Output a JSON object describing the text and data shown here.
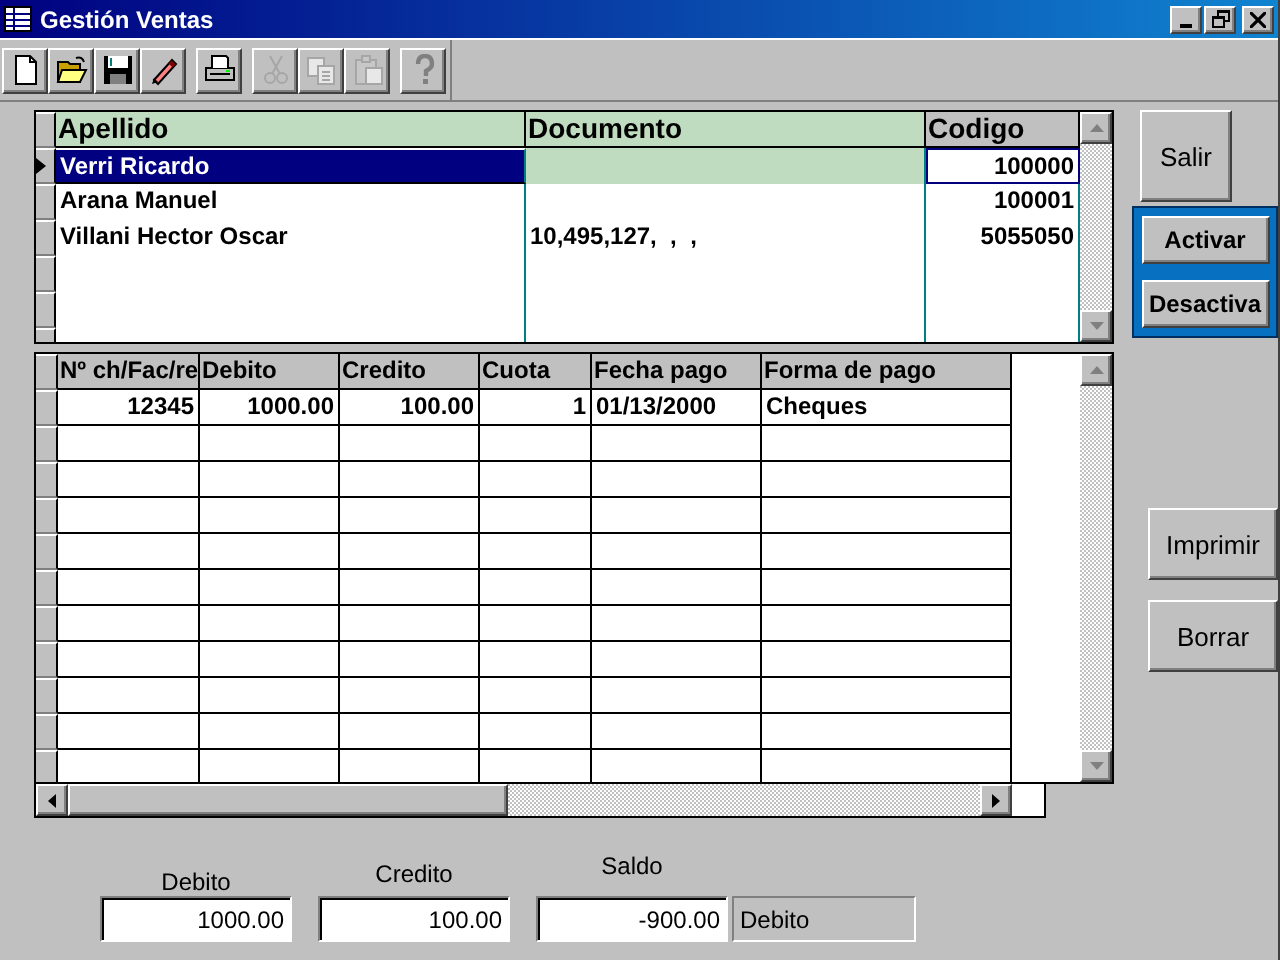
{
  "window": {
    "title": "Gestión Ventas"
  },
  "toolbar": [
    [
      {
        "kind": "new",
        "disabled": false
      },
      {
        "kind": "open",
        "disabled": false
      },
      {
        "kind": "save",
        "disabled": false
      },
      {
        "kind": "edit",
        "disabled": false
      }
    ],
    [
      {
        "kind": "print",
        "disabled": false
      }
    ],
    [
      {
        "kind": "cut",
        "disabled": true
      },
      {
        "kind": "copy",
        "disabled": true
      },
      {
        "kind": "paste",
        "disabled": true
      }
    ],
    [
      {
        "kind": "help",
        "disabled": false
      }
    ]
  ],
  "clients": {
    "columns": [
      {
        "label": "Apellido",
        "kind": "text",
        "highlighted": true
      },
      {
        "label": "Documento",
        "kind": "text",
        "highlighted": true
      },
      {
        "label": "Codigo",
        "kind": "number",
        "highlighted": false
      }
    ],
    "rows": [
      {
        "cells": [
          "Verri Ricardo",
          null,
          "100000"
        ],
        "selected": true
      },
      {
        "cells": [
          "Arana Manuel",
          null,
          "100001"
        ],
        "selected": false
      },
      {
        "cells": [
          "Villani Hector Oscar",
          "10,495,127,  ,  ,",
          "5055050"
        ],
        "selected": false
      }
    ]
  },
  "payments": {
    "columns": [
      {
        "label": "Nº ch/Fac/re",
        "kind": "number"
      },
      {
        "label": "Debito",
        "kind": "number"
      },
      {
        "label": "Credito",
        "kind": "number"
      },
      {
        "label": "Cuota",
        "kind": "number"
      },
      {
        "label": "Fecha pago",
        "kind": "text"
      },
      {
        "label": "Forma de  pago",
        "kind": "text"
      }
    ],
    "rows": [
      {
        "cells": [
          "12345",
          "1000.00",
          "100.00",
          "1",
          "01/13/2000",
          "Cheques"
        ]
      }
    ]
  },
  "side_buttons": {
    "exit": "Salir",
    "status_panel": [
      "Activar",
      "Desactiva"
    ],
    "actions": [
      "Imprimir",
      "Borrar"
    ]
  },
  "totals": [
    {
      "label": "Debito",
      "value": "1000.00"
    },
    {
      "label": "Credito",
      "value": "100.00"
    },
    {
      "label": "Saldo",
      "value": "-900.00"
    }
  ],
  "balance_type": "Debito"
}
